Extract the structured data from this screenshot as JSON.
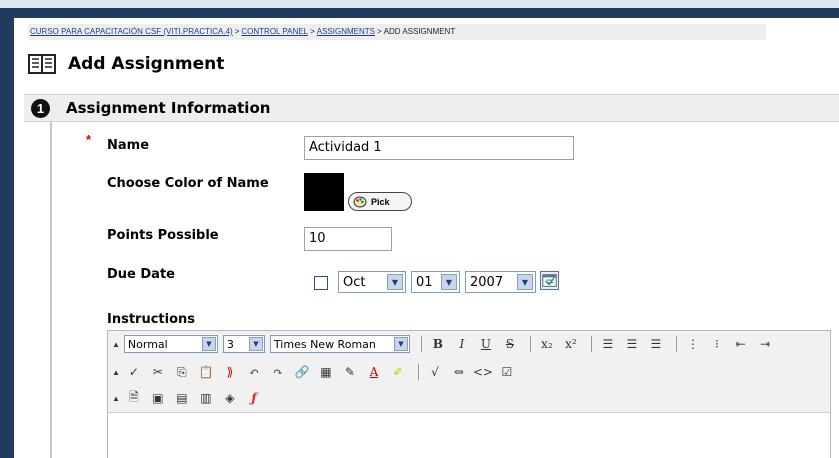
{
  "breadcrumb": {
    "items": [
      {
        "label": "CURSO PARA CAPACITACIÓN CSF (VITI.PRACTICA.4)",
        "link": true
      },
      {
        "label": "CONTROL PANEL",
        "link": true
      },
      {
        "label": "ASSIGNMENTS",
        "link": true
      },
      {
        "label": "ADD ASSIGNMENT",
        "link": false
      }
    ],
    "separator": ">"
  },
  "page": {
    "title": "Add Assignment",
    "icon": "book-icon"
  },
  "section": {
    "number": "1",
    "title": "Assignment Information"
  },
  "form": {
    "name_label": "Name",
    "name_value": "Actividad 1",
    "required_marker": "*",
    "color_label": "Choose Color of Name",
    "color_value": "#000000",
    "pick_label": "Pick",
    "points_label": "Points Possible",
    "points_value": "10",
    "due_label": "Due Date",
    "due_checked": false,
    "due_month": "Oct",
    "due_day": "01",
    "due_year": "2007",
    "instructions_label": "Instructions"
  },
  "editor": {
    "paragraph_style": "Normal",
    "font_size": "3",
    "font_family": "Times New Roman",
    "buttons_row1": [
      "B",
      "I",
      "U",
      "S",
      "x₂",
      "x²"
    ],
    "align_icons": [
      "align-left-icon",
      "align-center-icon",
      "align-right-icon"
    ],
    "list_icons": [
      "numbered-list-icon",
      "bullet-list-icon",
      "outdent-icon",
      "indent-icon"
    ],
    "row2_icons": [
      "spellcheck-icon",
      "cut-icon",
      "copy-icon",
      "paste-icon",
      "erase-icon",
      "undo-icon",
      "redo-icon",
      "link-icon",
      "table-icon",
      "pen-icon",
      "font-color-icon",
      "highlight-icon",
      "equation-icon",
      "html-embed-icon",
      "source-code-icon",
      "preview-icon"
    ],
    "row3_icons": [
      "attach-file-icon",
      "insert-image-icon",
      "insert-media-icon",
      "insert-document-icon",
      "mashup-icon",
      "flash-icon"
    ]
  }
}
